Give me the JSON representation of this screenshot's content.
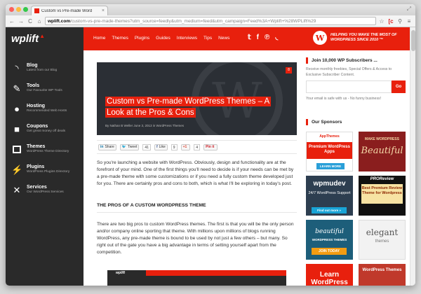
{
  "browser": {
    "tab_title": "Custom vs Pre-made Word",
    "tab_close": "×",
    "url_domain": "wplift.com",
    "url_path": "/custom-vs-pre-made-themes?utm_source=feedly&utm_medium=feed&utm_campaign=Feed%3A+Wplift+%28WPLift%29",
    "back": "←",
    "forward": "→",
    "reload": "C",
    "home": "⌂",
    "star": "☆",
    "ext1": "[c",
    "ext2": "⚲",
    "menu": "≡"
  },
  "site": {
    "logo": "wplift",
    "nav": [
      "Home",
      "Themes",
      "Plugins",
      "Guides",
      "Interviews",
      "Tips",
      "News"
    ],
    "social": [
      "y",
      "f",
      "p",
      "rss"
    ],
    "promo_text": "HELPING YOU MAKE THE MOST OF WORDPRESS SINCE 2010 ™"
  },
  "sidebar": {
    "items": [
      {
        "title": "Blog",
        "sub": "Latest from our Blog",
        "icon": "rss-icon"
      },
      {
        "title": "Tools",
        "sub": "Our Favourite WP Tools",
        "icon": "wrench-icon"
      },
      {
        "title": "Hosting",
        "sub": "Recommended Web Hosts",
        "icon": "globe-icon"
      },
      {
        "title": "Coupons",
        "sub": "Get great money off deals",
        "icon": "lock-icon"
      },
      {
        "title": "Themes",
        "sub": "WordPress Theme Directory",
        "icon": "layout-icon"
      },
      {
        "title": "Plugins",
        "sub": "WordPress Plugins Directory",
        "icon": "plug-icon"
      },
      {
        "title": "Services",
        "sub": "Our WordPress Services",
        "icon": "tools-icon"
      }
    ]
  },
  "article": {
    "badge": "8",
    "title": "Custom vs Pre-made WordPress Themes – A Look at the Pros & Cons",
    "meta": "By Nathan B Weller June 3, 2013 in WordPress Themes",
    "share": {
      "linkedin": "Share",
      "tweet": "Tweet",
      "tweet_count": "41",
      "like": "Like",
      "like_count": "9",
      "gplus": "+1",
      "gplus_count": "4",
      "pin": "Pin it"
    },
    "p1": "So you're launching a website with WordPress. Obviously, design and functionality are at the forefront of your mind. One of the first things you'll need to decide is if your needs can be met by a pre-made theme with some customizations or if you need a fully custom theme developed just for you. There are certainly pros and cons to both, which is what I'll be exploring in today's post.",
    "h3": "THE PROS OF A CUSTOM WORDPRESS THEME",
    "p2": "There are two big pros to custom WordPress themes. The first is that you will be the only person and/or company online sporting that theme. With millions upon millions of blogs running WordPress, any pre-made theme is bound to be used by not just a few others – but many. So right out of the gate you have a big advantage in terms of setting yourself apart from the competition.",
    "screenshot_logo": "wplift"
  },
  "right": {
    "subscribe_title": "Join 10,000 WP Subscribers ...",
    "subscribe_text": "Receive monthly freebies, Special Offers & Access to Exclusive Subscriber Content.",
    "go": "Go",
    "safe": "Your email is safe with us - No funny business!",
    "sponsors_title": "Our Sponsors",
    "ads": {
      "a1_brand": "AppThemes",
      "a1_title": "Premium WordPress Apps",
      "a1_cta": "LEARN MORE",
      "a2_top": "MAKE WORDPRESS",
      "a2_big": "Beautiful",
      "a3_brand": "wpmudev",
      "a3_line": "24/7 WordPress Support",
      "a3_cta": "Find out more »",
      "a4_brand": "PROReview",
      "a4_line": "Best Premium Review Theme for Wordpress",
      "a5_line1": "beautiful",
      "a5_line2": "WORDPRESS THEMES",
      "a5_cta": "JOIN TODAY",
      "a6_brand": "elegant",
      "a6_line": "themes",
      "a7_line": "Learn WordPress",
      "a8_line": "WordPress Themes"
    }
  }
}
